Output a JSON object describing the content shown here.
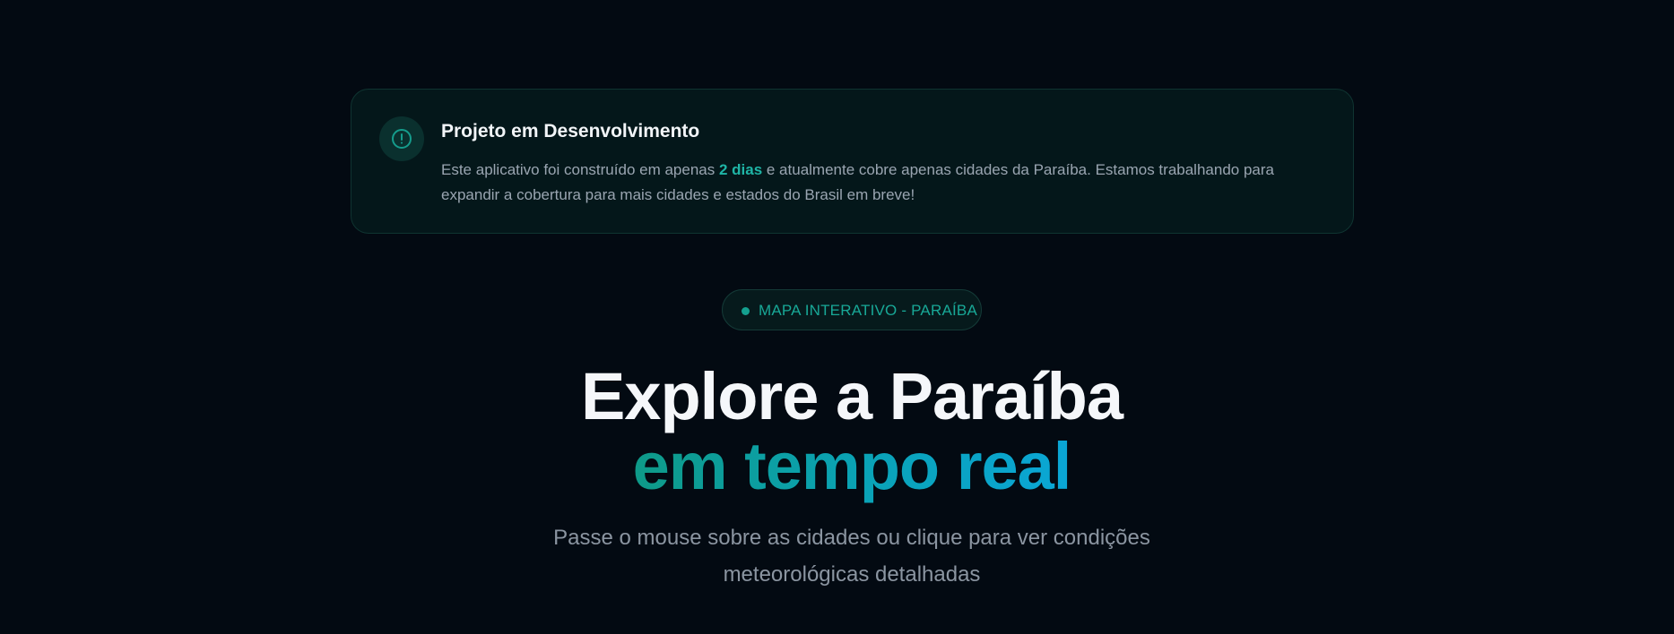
{
  "notice": {
    "icon": "alert-circle-icon",
    "title": "Projeto em Desenvolvimento",
    "text_before": "Este aplicativo foi construído em apenas ",
    "highlight": "2 dias",
    "text_after": " e atualmente cobre apenas cidades da Paraíba. Estamos trabalhando para expandir a cobertura para mais cidades e estados do Brasil em breve!"
  },
  "badge": {
    "label": "MAPA INTERATIVO - PARAÍBA"
  },
  "hero": {
    "line1": "Explore a Paraíba",
    "line2": "em tempo real"
  },
  "subtitle": "Passe o mouse sobre as cidades ou clique para ver condições meteorológicas detalhadas",
  "colors": {
    "background": "#030a12",
    "accent": "#14a08f",
    "gradient_start": "#0e9a88",
    "gradient_end": "#0aa6d6"
  }
}
